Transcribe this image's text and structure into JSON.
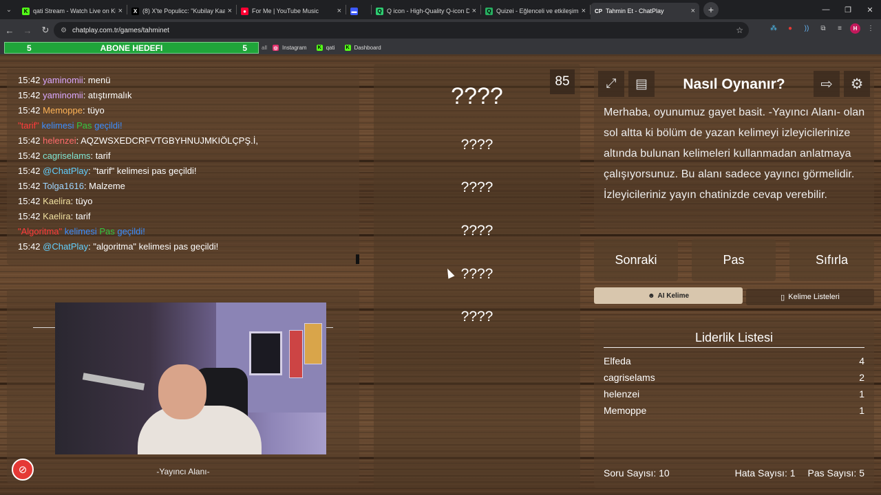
{
  "browser": {
    "tabs": [
      {
        "title": "qati Stream - Watch Live on Kick",
        "fav": "K",
        "fav_color": "#53fc18"
      },
      {
        "title": "(8) X'te Populicc: \"Kubilay Kaan",
        "fav": "X",
        "fav_color": "#000000"
      },
      {
        "title": "For Me | YouTube Music",
        "fav": "●",
        "fav_color": "#ff0033"
      },
      {
        "title": "",
        "fav": "▬",
        "fav_color": "#3d5afe"
      },
      {
        "title": "Q icon - High-Quality Q-icon D",
        "fav": "Q",
        "fav_color": "#2ecc71"
      },
      {
        "title": "Quizei - Eğlenceli ve etkileşimli",
        "fav": "Q",
        "fav_color": "#27ae60"
      },
      {
        "title": "Tahmin Et - ChatPlay",
        "fav": "CP",
        "fav_color": "#35363a"
      }
    ],
    "url": "chatplay.com.tr/games/tahminet",
    "bookmarks": [
      {
        "label": "Instagram",
        "icon": "instagram-icon"
      },
      {
        "label": "qati",
        "icon": "kick-icon"
      },
      {
        "label": "Dashboard",
        "icon": "kick-icon"
      }
    ],
    "profile_initial": "H"
  },
  "goal": {
    "left": "5",
    "label": "ABONE HEDEFI",
    "right": "5"
  },
  "chat": [
    {
      "time": "15:42",
      "user": "yaminomii",
      "uclass": "u1",
      "msg": ": menü"
    },
    {
      "time": "15:42",
      "user": "yaminomii",
      "uclass": "u1",
      "msg": ": atıştırmalık"
    },
    {
      "time": "15:42",
      "user": "Memoppe",
      "uclass": "u2",
      "msg": ": tüyo"
    },
    {
      "sys": true,
      "word": "\"tarif\"",
      "k": " kelimesi ",
      "p": "Pas",
      "g": " geçildi!"
    },
    {
      "time": "15:42",
      "user": "helenzei",
      "uclass": "u3",
      "msg": ": AQZWSXEDCRFVTGBYHNUJMKIÖLÇPŞ.İ,"
    },
    {
      "time": "15:42",
      "user": "cagriselams",
      "uclass": "u4",
      "msg": ": tarif"
    },
    {
      "time": "15:42",
      "user": "@ChatPlay",
      "uclass": "u5",
      "msg": ": \"tarif\" kelimesi pas geçildi!"
    },
    {
      "time": "15:42",
      "user": "Tolga1616",
      "uclass": "u6",
      "msg": ": Malzeme"
    },
    {
      "time": "15:42",
      "user": "Kaelira",
      "uclass": "u7",
      "msg": ": tüyo"
    },
    {
      "time": "15:42",
      "user": "Kaelira",
      "uclass": "u7",
      "msg": ": tarif"
    },
    {
      "sys": true,
      "word": "\"Algoritma\"",
      "k": " kelimesi ",
      "p": "Pas",
      "g": " geçildi!"
    },
    {
      "time": "15:42",
      "user": "@ChatPlay",
      "uclass": "u5",
      "msg": ": \"algoritma\" kelimesi pas geçildi!"
    }
  ],
  "cam": {
    "label": "-Yayıncı Alanı-"
  },
  "words": {
    "timer": "85",
    "items": [
      "????",
      "????",
      "????",
      "????",
      "????",
      "????"
    ]
  },
  "howto": {
    "title": "Nasıl Oynanır?",
    "text": "Merhaba, oyunumuz gayet basit. -Yayıncı Alanı- olan sol altta ki bölüm de yazan kelimeyi izleyicilerinize altında bulunan kelimeleri kullanmadan anlatmaya çalışıyorsunuz. Bu alanı sadece yayıncı görmelidir. İzleyicileriniz yayın chatinizde cevap verebilir."
  },
  "controls": {
    "next": "Sonraki",
    "pass": "Pas",
    "reset": "Sıfırla",
    "ai": "AI Kelime",
    "lists": "Kelime Listeleri"
  },
  "leaderboard": {
    "title": "Liderlik Listesi",
    "rows": [
      {
        "name": "Elfeda",
        "score": "4"
      },
      {
        "name": "cagriselams",
        "score": "2"
      },
      {
        "name": "helenzei",
        "score": "1"
      },
      {
        "name": "Memoppe",
        "score": "1"
      }
    ],
    "questions": "Soru Sayısı: 10",
    "errors": "Hata Sayısı: 1",
    "passes": "Pas Sayısı: 5"
  }
}
